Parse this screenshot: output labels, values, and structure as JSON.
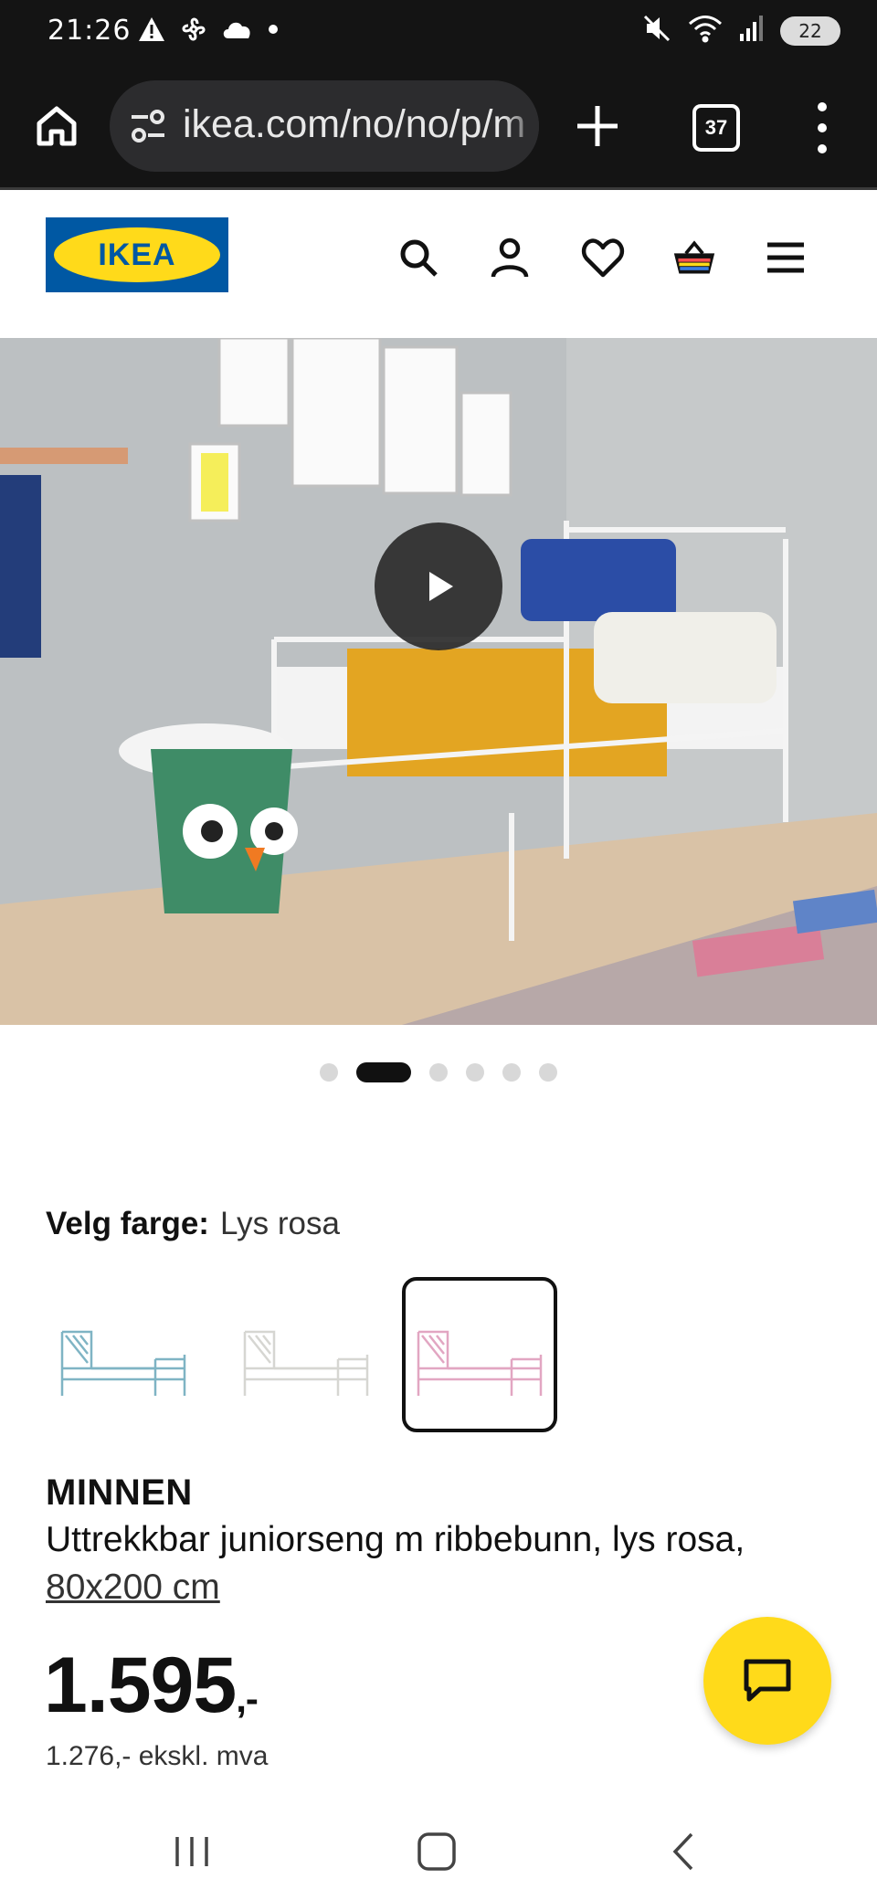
{
  "status_bar": {
    "time": "21:26",
    "battery": "22",
    "icons_left": [
      "warning-icon",
      "pinwheel-icon",
      "cloud-icon",
      "dot-icon"
    ],
    "icons_right": [
      "mute-icon",
      "wifi-icon",
      "signal-icon",
      "battery-icon"
    ]
  },
  "browser": {
    "url": "ikea.com/no/no/p/m",
    "tab_count": "37"
  },
  "header": {
    "logo_text": "IKEA",
    "icons": [
      "search-icon",
      "account-icon",
      "heart-icon",
      "basket-icon",
      "menu-icon"
    ]
  },
  "gallery": {
    "slide_count": 6,
    "active_slide": 2
  },
  "color_picker": {
    "label": "Velg farge:",
    "selected": "Lys rosa",
    "options": [
      "light blue",
      "white",
      "light pink"
    ]
  },
  "product": {
    "name": "MINNEN",
    "description": "Uttrekkbar juniorseng m ribbebunn, lys rosa,",
    "size": "80x200 cm",
    "price": "1.595",
    "price_suffix": ",-",
    "price_ex_vat": "1.276,- ekskl. mva"
  },
  "colors": {
    "ikea_blue": "#0058a3",
    "ikea_yellow": "#ffda1a"
  }
}
